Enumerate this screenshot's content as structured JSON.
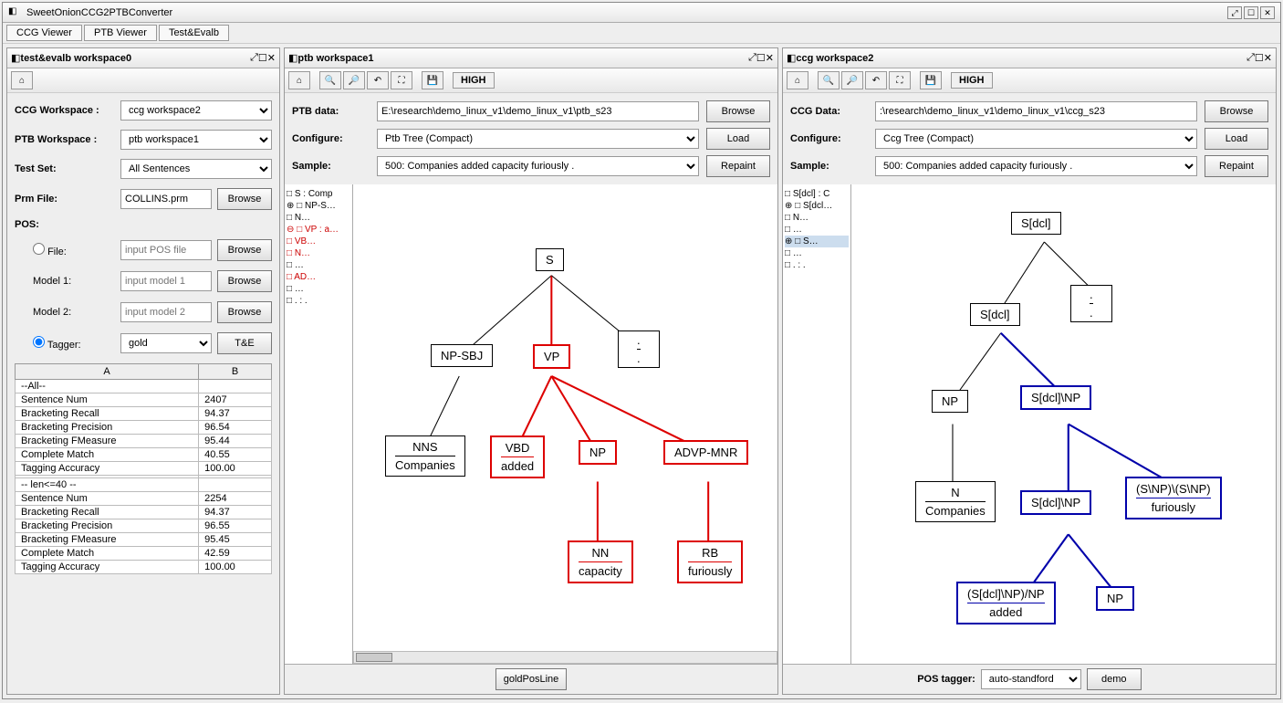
{
  "app": {
    "title": "SweetOnionCCG2PTBConverter",
    "tabs": [
      "CCG Viewer",
      "PTB Viewer",
      "Test&Evalb"
    ]
  },
  "ws0": {
    "title": "test&evalb workspace0",
    "labels": {
      "ccg_ws": "CCG Workspace :",
      "ptb_ws": "PTB Workspace :",
      "test_set": "Test Set:",
      "prm_file": "Prm File:",
      "pos": "POS:",
      "file": "File:",
      "model1": "Model 1:",
      "model2": "Model 2:",
      "tagger": "Tagger:"
    },
    "values": {
      "ccg_ws": "ccg workspace2",
      "ptb_ws": "ptb workspace1",
      "test_set": "All Sentences",
      "prm_file": "COLLINS.prm",
      "file_ph": "input POS file",
      "model1_ph": "input model 1",
      "model2_ph": "input model 2",
      "tagger": "gold",
      "browse": "Browse",
      "te": "T&E"
    },
    "table": {
      "headers": [
        "A",
        "B"
      ],
      "rows": [
        [
          "--All--",
          ""
        ],
        [
          "Sentence Num",
          "2407"
        ],
        [
          "Bracketing Recall",
          "94.37"
        ],
        [
          "Bracketing Precision",
          "96.54"
        ],
        [
          "Bracketing FMeasure",
          "95.44"
        ],
        [
          "Complete Match",
          "40.55"
        ],
        [
          "Tagging Accuracy",
          "100.00"
        ],
        [
          "",
          ""
        ],
        [
          "-- len<=40 --",
          ""
        ],
        [
          "Sentence Num",
          "2254"
        ],
        [
          "Bracketing Recall",
          "94.37"
        ],
        [
          "Bracketing Precision",
          "96.55"
        ],
        [
          "Bracketing FMeasure",
          "95.45"
        ],
        [
          "Complete Match",
          "42.59"
        ],
        [
          "Tagging Accuracy",
          "100.00"
        ]
      ]
    }
  },
  "ws1": {
    "title": "ptb workspace1",
    "badge": "HIGH",
    "labels": {
      "data": "PTB data:",
      "configure": "Configure:",
      "sample": "Sample:"
    },
    "values": {
      "data": "E:\\research\\demo_linux_v1\\demo_linux_v1\\ptb_s23",
      "configure": "Ptb Tree (Compact)",
      "sample": "500: Companies added capacity furiously .",
      "browse": "Browse",
      "load": "Load",
      "repaint": "Repaint"
    },
    "tree": [
      {
        "t": "□ S : Comp",
        "c": ""
      },
      {
        "t": "  ⊕ □ NP-S…",
        "c": ""
      },
      {
        "t": "      □ N…",
        "c": ""
      },
      {
        "t": "  ⊖ □ VP : a…",
        "c": "red"
      },
      {
        "t": "      □ VB…",
        "c": "red"
      },
      {
        "t": "      □ N…",
        "c": "red"
      },
      {
        "t": "      □ …",
        "c": ""
      },
      {
        "t": "      □ AD…",
        "c": "red"
      },
      {
        "t": "      □ …",
        "c": ""
      },
      {
        "t": "□ . : .",
        "c": ""
      }
    ],
    "nodes": {
      "s": "S",
      "npsbj": "NP-SBJ",
      "vp": "VP",
      "dot": ".",
      "dot2": ".",
      "nns": "NNS",
      "companies": "Companies",
      "vbd": "VBD",
      "added": "added",
      "np": "NP",
      "advp": "ADVP-MNR",
      "nn": "NN",
      "capacity": "capacity",
      "rb": "RB",
      "furiously": "furiously"
    },
    "bottom": "goldPosLine"
  },
  "ws2": {
    "title": "ccg workspace2",
    "badge": "HIGH",
    "labels": {
      "data": "CCG Data:",
      "configure": "Configure:",
      "sample": "Sample:"
    },
    "values": {
      "data": ":\\research\\demo_linux_v1\\demo_linux_v1\\ccg_s23",
      "configure": "Ccg Tree (Compact)",
      "sample": "500: Companies added capacity furiously .",
      "browse": "Browse",
      "load": "Load",
      "repaint": "Repaint"
    },
    "tree": [
      {
        "t": "□ S[dcl] : C",
        "c": ""
      },
      {
        "t": "  ⊕ □ S[dcl…",
        "c": ""
      },
      {
        "t": "      □ N…",
        "c": ""
      },
      {
        "t": "      □ …",
        "c": ""
      },
      {
        "t": "  ⊕ □ S…",
        "c": "sel"
      },
      {
        "t": "      □ …",
        "c": ""
      },
      {
        "t": "□ . : .",
        "c": ""
      }
    ],
    "nodes": {
      "root": "S[dcl]",
      "dot": ".",
      "dot2": ".",
      "sdcl2": "S[dcl]",
      "np": "NP",
      "sdclnp": "S[dcl]\\NP",
      "n": "N",
      "companies": "Companies",
      "sdclnp2": "S[dcl]\\NP",
      "snp_snp": "(S\\NP)\\(S\\NP)",
      "furiously": "furiously",
      "sdclnp_np": "(S[dcl]\\NP)/NP",
      "added": "added",
      "np2": "NP"
    },
    "bottom": {
      "label": "POS tagger:",
      "select": "auto-standford",
      "btn": "demo"
    }
  }
}
